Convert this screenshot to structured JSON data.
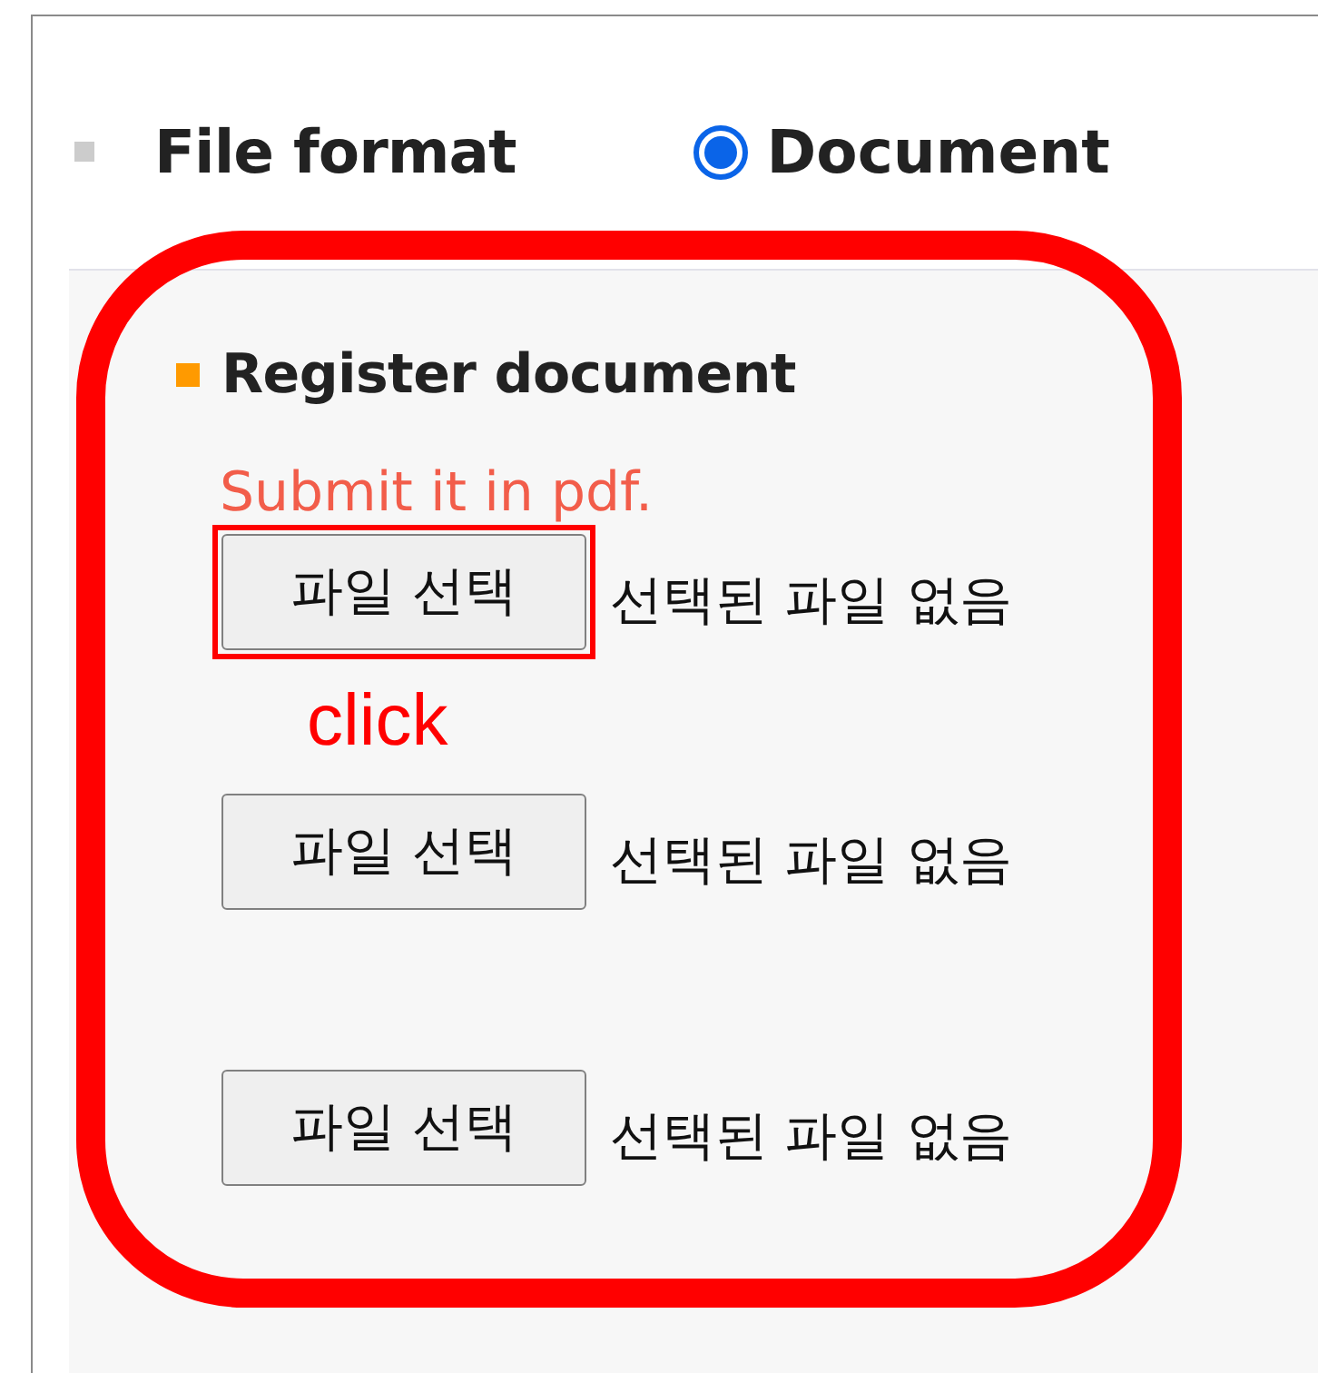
{
  "header": {
    "label": "File format",
    "option": {
      "label": "Document",
      "selected": true
    }
  },
  "section": {
    "title": "Register document",
    "note": "Submit it in pdf.",
    "files": [
      {
        "button": "파일 선택",
        "status": "선택된 파일 없음",
        "highlighted": true,
        "callout": "click"
      },
      {
        "button": "파일 선택",
        "status": "선택된 파일 없음",
        "highlighted": false
      },
      {
        "button": "파일 선택",
        "status": "선택된 파일 없음",
        "highlighted": false
      }
    ]
  },
  "annotation": {
    "outlined": true
  }
}
